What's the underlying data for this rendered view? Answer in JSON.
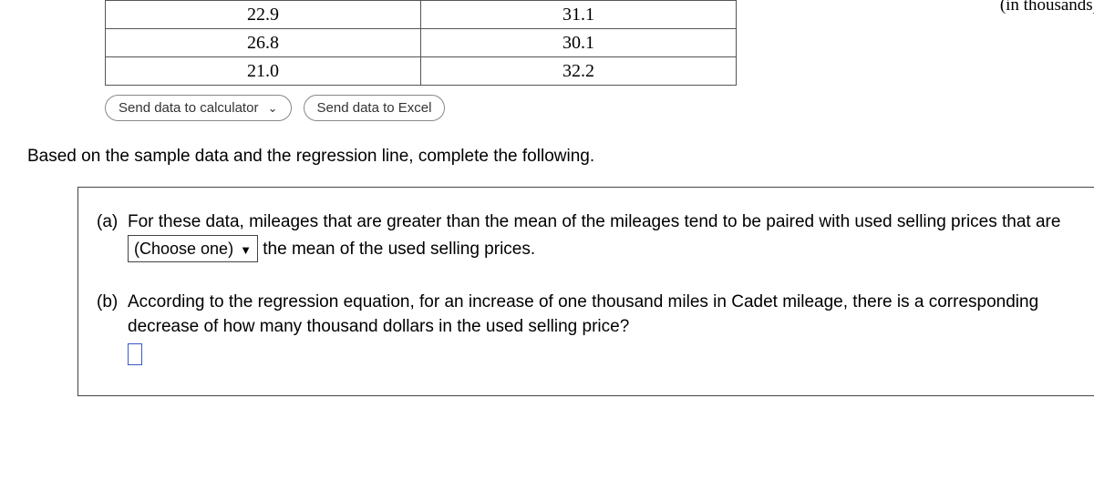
{
  "header_hint": "(in thousands)",
  "table": {
    "rows": [
      {
        "c1": "22.9",
        "c2": "31.1"
      },
      {
        "c1": "26.8",
        "c2": "30.1"
      },
      {
        "c1": "21.0",
        "c2": "32.2"
      }
    ]
  },
  "buttons": {
    "calc": "Send data to calculator",
    "excel": "Send data to Excel"
  },
  "instruction": "Based on the sample data and the regression line, complete the following.",
  "qa": {
    "a": {
      "label": "(a)",
      "text1": "For these data, mileages that are greater than the mean of the mileages tend to be paired with used selling prices that are ",
      "dropdown": "(Choose one)",
      "text2": " the mean of the used selling prices."
    },
    "b": {
      "label": "(b)",
      "text": "According to the regression equation, for an increase of one thousand miles in Cadet mileage, there is a corresponding decrease of how many thousand dollars in the used selling price?"
    }
  }
}
